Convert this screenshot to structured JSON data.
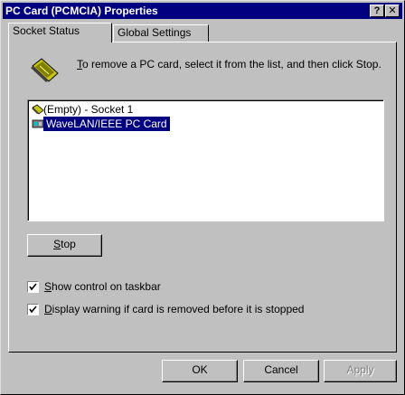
{
  "window": {
    "title": "PC Card (PCMCIA) Properties"
  },
  "titlebar": {
    "help_label": "?",
    "close_label": "✕"
  },
  "tabs": [
    {
      "label": "Socket Status",
      "active": true
    },
    {
      "label": "Global Settings",
      "active": false
    }
  ],
  "info": {
    "text_first": "T",
    "text_rest": "o remove a PC card, select it from the list, and then click Stop.",
    "icon": "pc-card-icon"
  },
  "list": {
    "items": [
      {
        "label": "(Empty) - Socket 1",
        "selected": false,
        "icon": "pc-card-icon"
      },
      {
        "label": "WaveLAN/IEEE PC Card",
        "selected": true,
        "icon": "network-card-icon"
      }
    ]
  },
  "stop": {
    "label_first": "S",
    "label_rest": "top"
  },
  "checkboxes": [
    {
      "label_first": "S",
      "label_rest": "how control on taskbar",
      "checked": true
    },
    {
      "label_first": "D",
      "label_rest": "isplay warning if card is removed before it is stopped",
      "checked": true
    }
  ],
  "buttons": {
    "ok": "OK",
    "cancel": "Cancel",
    "apply": "Apply"
  },
  "colors": {
    "titlebar": "#000080",
    "face": "#c0c0c0",
    "selection": "#000080"
  }
}
